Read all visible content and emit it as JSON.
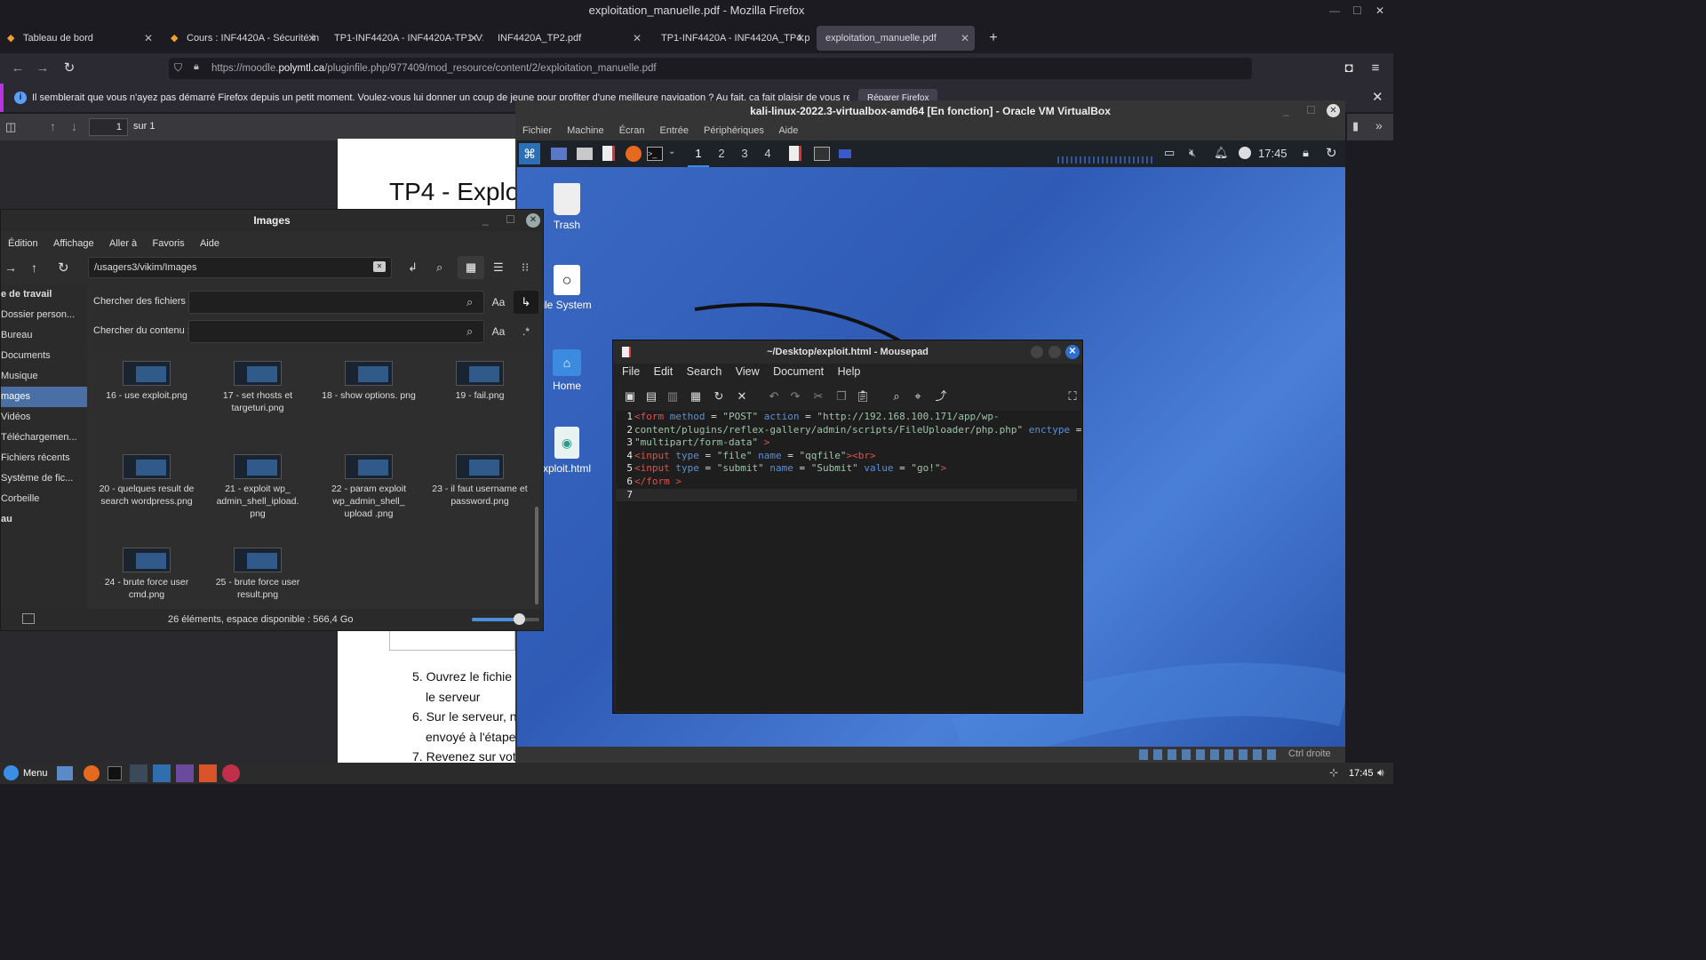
{
  "firefox": {
    "window_title": "exploitation_manuelle.pdf - Mozilla Firefox",
    "tabs": [
      {
        "label": "Tableau de bord"
      },
      {
        "label": "Cours : INF4420A - Sécurité in"
      },
      {
        "label": "TP1-INF4420A - INF4420A-TP1-V2."
      },
      {
        "label": "INF4420A_TP2.pdf"
      },
      {
        "label": "TP1-INF4420A - INF4420A_TP4.pdf"
      },
      {
        "label": "exploitation_manuelle.pdf"
      }
    ],
    "url_prefix": "https://moodle.",
    "url_domain": "polymtl.ca",
    "url_path": "/pluginfile.php/977409/mod_resource/content/2/exploitation_manuelle.pdf",
    "notification": "Il semblerait que vous n'ayez pas démarré Firefox depuis un petit moment. Voulez-vous lui donner un coup de jeune pour profiter d'une meilleure navigation ? Au fait, ça fait plaisir de vous retrouver !",
    "notification_button": "Réparer Firefox",
    "pdf_page_value": "1",
    "pdf_page_total": "sur 1"
  },
  "pdf": {
    "heading": "TP4 - Explo",
    "items": [
      {
        "num": "5.",
        "line1": "Ouvrez le fichie",
        "line2": "le serveur"
      },
      {
        "num": "6.",
        "line1": "Sur le serveur, n",
        "line2": "envoyé à l'étape"
      },
      {
        "num": "7.",
        "line1": "Revenez sur vot",
        "line2": ""
      }
    ]
  },
  "file_manager": {
    "title": "Images",
    "menu": [
      "Édition",
      "Affichage",
      "Aller à",
      "Favoris",
      "Aide"
    ],
    "path": "/usagers3/vikim/Images",
    "search_files_label": "Chercher des fichiers :",
    "search_content_label": "Chercher du contenu :",
    "case_label": "Aa",
    "regex_label": ".*",
    "sidebar": [
      {
        "label": "e de travail",
        "selected": false,
        "bold": true
      },
      {
        "label": "Dossier person...",
        "selected": false
      },
      {
        "label": "Bureau",
        "selected": false
      },
      {
        "label": "Documents",
        "selected": false
      },
      {
        "label": "Musique",
        "selected": false
      },
      {
        "label": "mages",
        "selected": true
      },
      {
        "label": "Vidéos",
        "selected": false
      },
      {
        "label": "Téléchargemen...",
        "selected": false
      },
      {
        "label": "Fichiers récents",
        "selected": false
      },
      {
        "label": "Système de fic...",
        "selected": false
      },
      {
        "label": "Corbeille",
        "selected": false
      },
      {
        "label": "au",
        "selected": false,
        "bold": true
      }
    ],
    "files": [
      {
        "name": "16 - use exploit.png"
      },
      {
        "name": "17 - set rhosts et targeturi.png"
      },
      {
        "name": "18 - show options. png"
      },
      {
        "name": "19 - fail.png"
      },
      {
        "name": "20 - quelques result de search wordpress.png"
      },
      {
        "name": "21 - exploit wp_ admin_shell_ipload. png"
      },
      {
        "name": "22 - param exploit wp_admin_shell_ upload .png"
      },
      {
        "name": "23 - il faut username et password.png"
      },
      {
        "name": "24 - brute force user cmd.png"
      },
      {
        "name": "25 - brute force user result.png"
      }
    ],
    "status": "26 éléments, espace disponible : 566,4 Go",
    "zoom_level": 0.7
  },
  "vbox": {
    "title": "kali-linux-2022.3-virtualbox-amd64 [En fonction] - Oracle VM VirtualBox",
    "menu": [
      "Fichier",
      "Machine",
      "Écran",
      "Entrée",
      "Périphériques",
      "Aide"
    ],
    "workspaces": [
      "1",
      "2",
      "3",
      "4"
    ],
    "clock": "17:45",
    "host_key": "Ctrl droite",
    "desktop_icons": [
      {
        "label": "Trash",
        "icon": "trash-icon"
      },
      {
        "label": "ile System",
        "icon": "drive-icon"
      },
      {
        "label": "Home",
        "icon": "home-icon"
      },
      {
        "label": "xploit.html",
        "icon": "html-file-icon"
      }
    ]
  },
  "mousepad": {
    "title": "~/Desktop/exploit.html - Mousepad",
    "menu": [
      "File",
      "Edit",
      "Search",
      "View",
      "Document",
      "Help"
    ],
    "line_numbers": [
      "1",
      "2",
      "3",
      "4",
      "5",
      "6",
      "7"
    ]
  },
  "taskbar": {
    "menu_label": "Menu",
    "clock": "17:45"
  }
}
